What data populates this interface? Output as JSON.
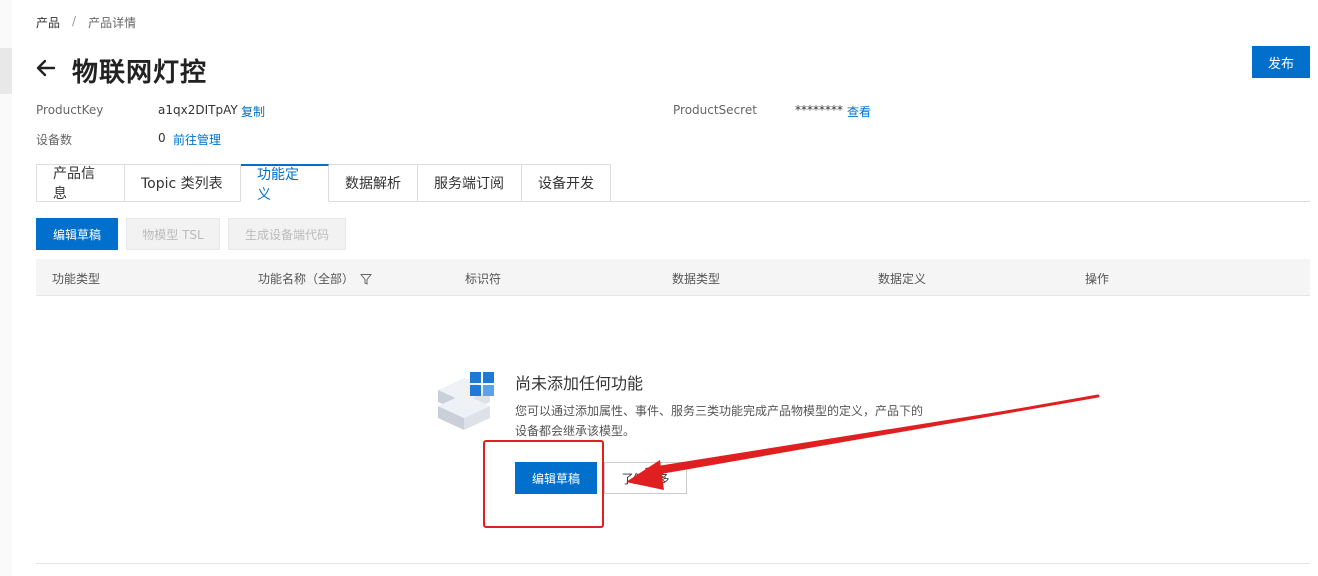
{
  "breadcrumb": {
    "root": "产品",
    "separator": "/",
    "current": "产品详情"
  },
  "header": {
    "title": "物联网灯控",
    "publish_label": "发布"
  },
  "meta": {
    "product_key_label": "ProductKey",
    "product_key_value": "a1qx2DITpAY",
    "copy_label": "复制",
    "device_count_label": "设备数",
    "device_count_value": "0",
    "manage_link": "前往管理",
    "product_secret_label": "ProductSecret",
    "product_secret_value": "********",
    "view_label": "查看"
  },
  "tabs": [
    {
      "label": "产品信息"
    },
    {
      "label": "Topic 类列表"
    },
    {
      "label": "功能定义"
    },
    {
      "label": "数据解析"
    },
    {
      "label": "服务端订阅"
    },
    {
      "label": "设备开发"
    }
  ],
  "active_tab": "功能定义",
  "toolbar": {
    "edit_draft": "编辑草稿",
    "tsl_model": "物模型 TSL",
    "gen_code": "生成设备端代码"
  },
  "table": {
    "columns": [
      "功能类型",
      "功能名称（全部）",
      "标识符",
      "数据类型",
      "数据定义",
      "操作"
    ]
  },
  "empty": {
    "title": "尚未添加任何功能",
    "description": "您可以通过添加属性、事件、服务三类功能完成产品物模型的定义，产品下的设备都会继承该模型。",
    "edit_button": "编辑草稿",
    "learn_more": "了解更多"
  },
  "colors": {
    "primary": "#0070cc",
    "annotation": "#e02020"
  }
}
